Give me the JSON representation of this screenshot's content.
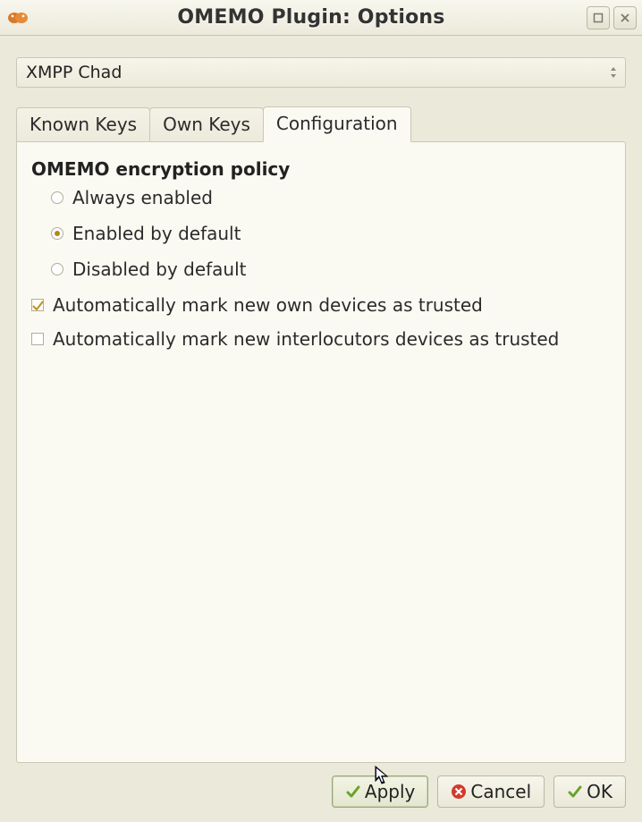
{
  "window": {
    "title": "OMEMO Plugin: Options"
  },
  "account_selector": {
    "value": "XMPP Chad"
  },
  "tabs": {
    "known_keys": "Known Keys",
    "own_keys": "Own Keys",
    "configuration": "Configuration",
    "active": "configuration"
  },
  "config": {
    "policy_title": "OMEMO encryption policy",
    "radio_always": "Always enabled",
    "radio_enabled_default": "Enabled by default",
    "radio_disabled_default": "Disabled by default",
    "policy_selected": "enabled_default",
    "check_own_devices": "Automatically mark new own devices as trusted",
    "check_own_devices_value": true,
    "check_interlocutor_devices": "Automatically mark new interlocutors devices as trusted",
    "check_interlocutor_devices_value": false
  },
  "buttons": {
    "apply": "Apply",
    "cancel": "Cancel",
    "ok": "OK"
  }
}
